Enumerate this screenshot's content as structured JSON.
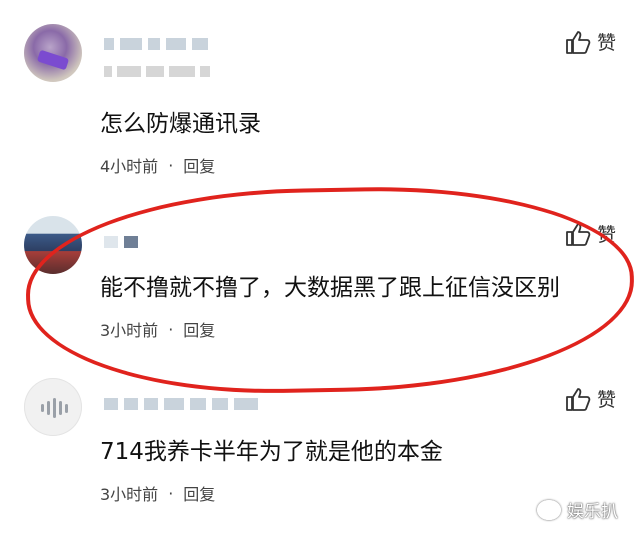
{
  "like_label": "赞",
  "comments": [
    {
      "text": "怎么防爆通讯录",
      "time": "4小时前",
      "reply": "回复",
      "separator": "·"
    },
    {
      "text": "能不撸就不撸了，大数据黑了跟上征信没区别",
      "time": "3小时前",
      "reply": "回复",
      "separator": "·"
    },
    {
      "text": "714我养卡半年为了就是他的本金",
      "time": "3小时前",
      "reply": "回复",
      "separator": "·"
    }
  ],
  "watermark": "娱乐扒",
  "colors": {
    "highlight": "#e0231d",
    "text": "#111111",
    "meta": "#444444"
  }
}
